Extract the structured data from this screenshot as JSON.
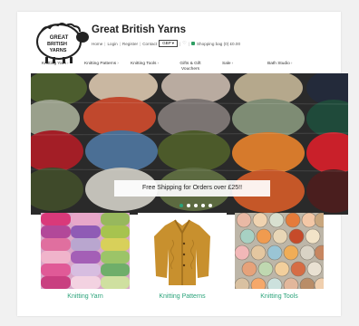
{
  "header": {
    "logo_lines": [
      "GREAT",
      "BRITISH",
      "YARNS"
    ],
    "site_title": "Great British Yarns",
    "account_links": [
      "Home",
      "Login",
      "Register",
      "Contact"
    ],
    "currency": "GBP",
    "shopping_bag": "Shopping bag (0) £0.00"
  },
  "nav": {
    "items": [
      {
        "label": "Knitting Yarn",
        "has_caret": true
      },
      {
        "label": "Knitting Patterns",
        "has_caret": true
      },
      {
        "label": "Knitting Tools",
        "has_caret": true
      },
      {
        "label": "Gifts & Gift Vouchers",
        "has_caret": false
      },
      {
        "label": "Sale",
        "has_caret": true
      },
      {
        "label": "Bath Studio",
        "has_caret": true
      }
    ]
  },
  "hero": {
    "banner_text": "Free Shipping for Orders over £25!!",
    "slide_count": 5,
    "active_slide": 1
  },
  "categories": [
    {
      "label": "Knitting Yarn"
    },
    {
      "label": "Knitting Patterns"
    },
    {
      "label": "Knitting Tools"
    }
  ],
  "colors": {
    "accent_green": "#2aa37a",
    "bag_icon": "#2f9f63"
  }
}
